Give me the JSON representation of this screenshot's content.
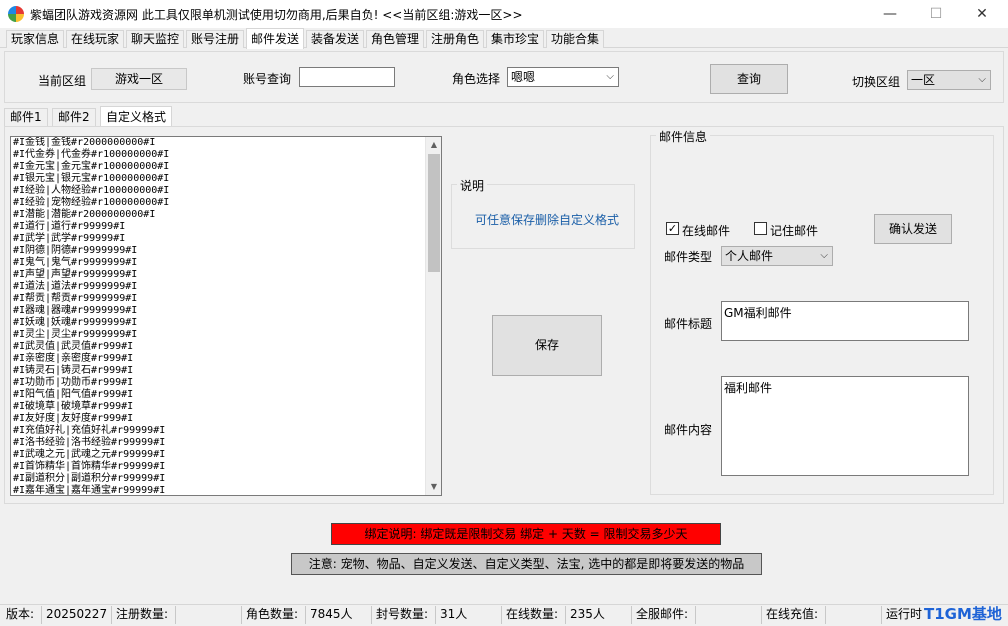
{
  "window": {
    "title": "紫蝠团队游戏资源网 此工具仅限单机测试使用切勿商用,后果自负! <<当前区组:游戏一区>>",
    "minimize": "—",
    "maximize": "☐",
    "close": "✕"
  },
  "menu_tabs": [
    "玩家信息",
    "在线玩家",
    "聊天监控",
    "账号注册",
    "邮件发送",
    "装备发送",
    "角色管理",
    "注册角色",
    "集市珍宝",
    "功能合集"
  ],
  "active_menu_tab": "邮件发送",
  "top": {
    "current_group_label": "当前区组",
    "current_group_value": "游戏一区",
    "account_query_label": "账号查询",
    "account_query_value": "",
    "role_select_label": "角色选择",
    "role_select_value": "嗯嗯",
    "query_button": "查询",
    "switch_group_label": "切换区组",
    "switch_group_value": "一区"
  },
  "sub_tabs": [
    "邮件1",
    "邮件2",
    "自定义格式"
  ],
  "active_sub_tab": "自定义格式",
  "custom_lines": [
    "#I金钱|金钱#r2000000000#I",
    "#I代金券|代金券#r100000000#I",
    "#I金元宝|金元宝#r100000000#I",
    "#I银元宝|银元宝#r100000000#I",
    "#I经验|人物经验#r100000000#I",
    "#I经验|宠物经验#r100000000#I",
    "#I潜能|潜能#r2000000000#I",
    "#I道行|道行#r99999#I",
    "#I武学|武学#r99999#I",
    "#I阴德|阴德#r9999999#I",
    "#I鬼气|鬼气#r9999999#I",
    "#I声望|声望#r9999999#I",
    "#I道法|道法#r9999999#I",
    "#I帮贡|帮贡#r9999999#I",
    "#I器魂|器魂#r9999999#I",
    "#I妖魂|妖魂#r9999999#I",
    "#I灵尘|灵尘#r9999999#I",
    "#I武灵值|武灵值#r999#I",
    "#I亲密度|亲密度#r999#I",
    "#I铸灵石|铸灵石#r999#I",
    "#I功勋币|功勋币#r999#I",
    "#I阳气值|阳气值#r999#I",
    "#I破境草|破境草#r999#I",
    "#I友好度|友好度#r999#I",
    "#I充值好礼|充值好礼#r99999#I",
    "#I洛书经验|洛书经验#r99999#I",
    "#I武魂之元|武魂之元#r99999#I",
    "#I首饰精华|首饰精华#r99999#I",
    "#I副道积分|副道积分#r99999#I",
    "#I嘉年通宝|嘉年通宝#r99999#I"
  ],
  "explain": {
    "title": "说明",
    "text": "可任意保存删除自定义格式"
  },
  "save_button": "保存",
  "mail_info": {
    "title": "邮件信息",
    "online_mail_label": "在线邮件",
    "online_mail_checked": true,
    "remember_mail_label": "记住邮件",
    "remember_mail_checked": false,
    "confirm_button": "确认发送",
    "mail_type_label": "邮件类型",
    "mail_type_value": "个人邮件",
    "mail_title_label": "邮件标题",
    "mail_title_value": "GM福利邮件",
    "mail_content_label": "邮件内容",
    "mail_content_value": "福利邮件"
  },
  "notices": {
    "bind": "绑定说明: 绑定既是限制交易 绑定 + 天数 = 限制交易多少天",
    "note": "注意: 宠物、物品、自定义发送、自定义类型、法宝, 选中的都是即将要发送的物品"
  },
  "status": {
    "version_label": "版本:",
    "version_value": "20250227",
    "reg_label": "注册数量:",
    "reg_value": "",
    "role_label": "角色数量:",
    "role_value": "7845人",
    "ban_label": "封号数量:",
    "ban_value": "31人",
    "online_label": "在线数量:",
    "online_value": "235人",
    "server_mail_label": "全服邮件:",
    "online_recharge_label": "在线充值:",
    "runtime_label": "运行时"
  },
  "watermark": "T1GM基地",
  "colors": {
    "accent_blue": "#1e63d6",
    "notice_red": "#ff0000",
    "explain_text": "#1b5fa8"
  }
}
